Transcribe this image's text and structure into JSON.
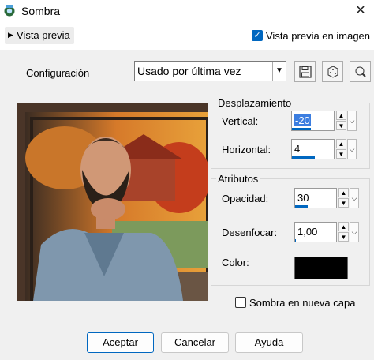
{
  "window": {
    "title": "Sombra"
  },
  "preview_toggle": {
    "label": "Vista previa"
  },
  "preview_in_image": {
    "label": "Vista previa en imagen",
    "checked": true
  },
  "config": {
    "label": "Configuración",
    "value": "Usado por última vez"
  },
  "toolbar": {
    "save_icon": "save-icon",
    "random_icon": "dice-icon",
    "reset_icon": "reset-icon"
  },
  "offset": {
    "legend": "Desplazamiento",
    "vertical": {
      "label": "Vertical:",
      "value": "-20",
      "fill": 0.45
    },
    "horizontal": {
      "label": "Horizontal:",
      "value": "4",
      "fill": 0.55
    }
  },
  "attributes": {
    "legend": "Atributos",
    "opacity": {
      "label": "Opacidad:",
      "value": "30",
      "fill": 0.3
    },
    "blur": {
      "label": "Desenfocar:",
      "value": "1,00",
      "fill": 0.02
    },
    "color": {
      "label": "Color:",
      "value": "#000000"
    }
  },
  "shadow_new_layer": {
    "label": "Sombra en nueva capa",
    "checked": false
  },
  "buttons": {
    "ok": "Aceptar",
    "cancel": "Cancelar",
    "help": "Ayuda"
  }
}
